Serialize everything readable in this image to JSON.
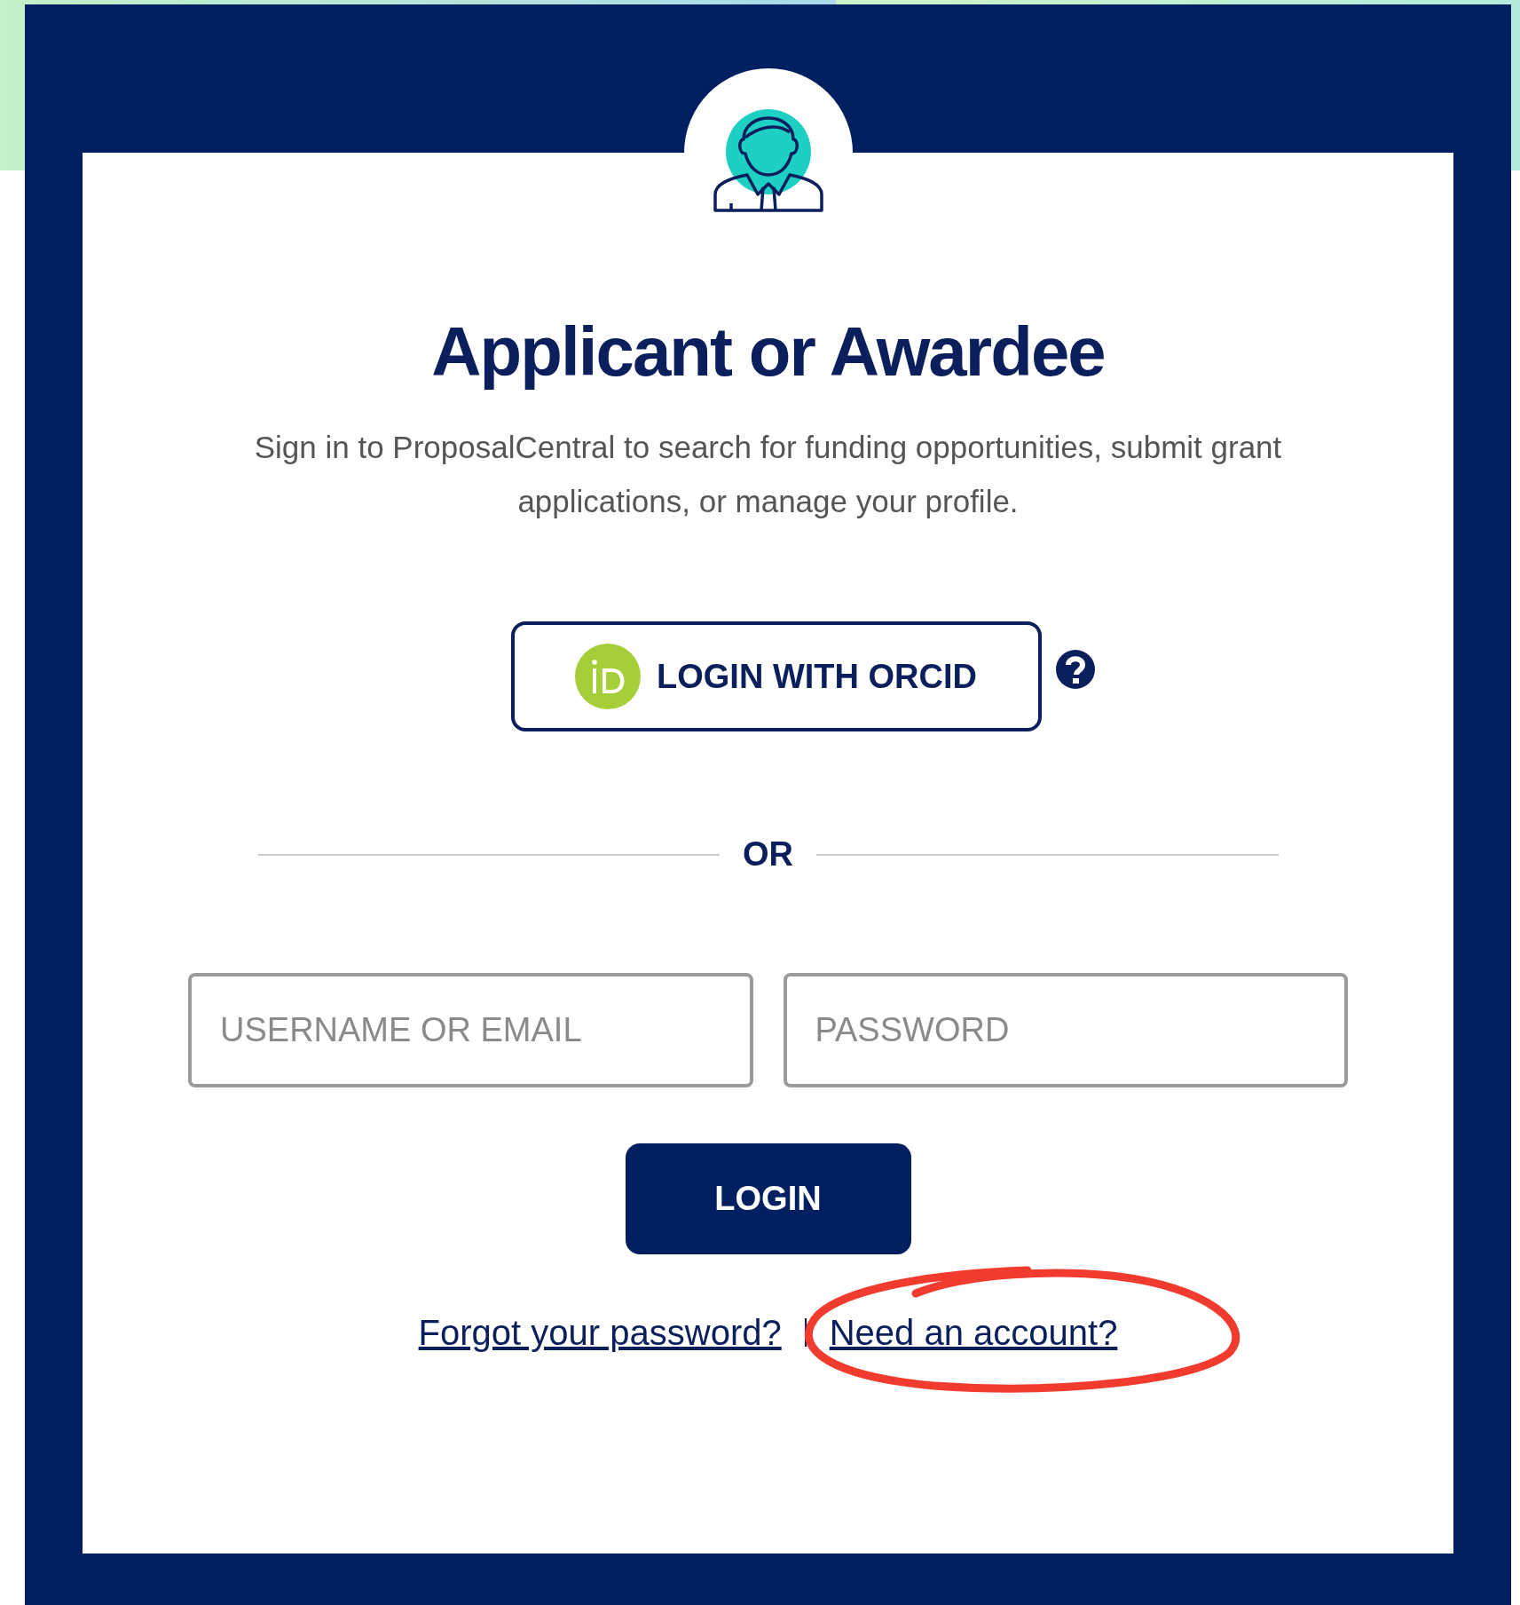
{
  "title": "Applicant or Awardee",
  "subtitle": "Sign in to ProposalCentral to search for funding opportunities, submit grant applications, or manage your profile.",
  "orcid_button": {
    "label": "LOGIN WITH ORCID"
  },
  "divider": "OR",
  "fields": [
    {
      "placeholder": "USERNAME OR EMAIL"
    },
    {
      "placeholder": "PASSWORD"
    }
  ],
  "login_button": "LOGIN",
  "links": [
    "Forgot your password?",
    "Need an account?"
  ]
}
